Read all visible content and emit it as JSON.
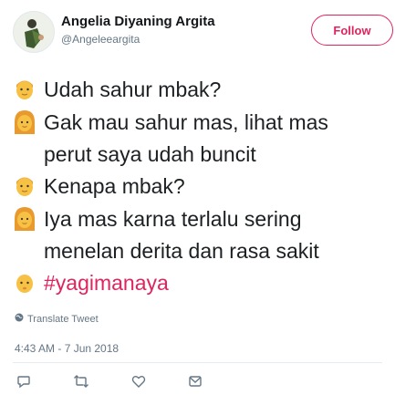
{
  "author": {
    "name": "Angelia Diyaning Argita",
    "handle": "@Angeleeargita"
  },
  "follow_label": "Follow",
  "tweet_lines": [
    {
      "emoji": "man-emoji",
      "text": "Udah sahur mbak?"
    },
    {
      "emoji": "woman-emoji",
      "text": "Gak mau sahur mas, lihat mas"
    },
    {
      "emoji": "",
      "text": "perut saya udah buncit"
    },
    {
      "emoji": "man-emoji",
      "text": "Kenapa mbak?"
    },
    {
      "emoji": "woman-emoji",
      "text": "Iya mas karna terlalu sering"
    },
    {
      "emoji": "",
      "text": " menelan derita dan rasa sakit"
    },
    {
      "emoji": "baby-emoji",
      "text": "#yagimanaya"
    }
  ],
  "translate_label": "Translate Tweet",
  "timestamp": "4:43 AM - 7 Jun 2018",
  "actions": [
    "reply-icon",
    "retweet-icon",
    "like-icon",
    "message-icon"
  ],
  "colors": {
    "accent": "#e0245e",
    "muted": "#657786",
    "text": "#1c2022"
  }
}
